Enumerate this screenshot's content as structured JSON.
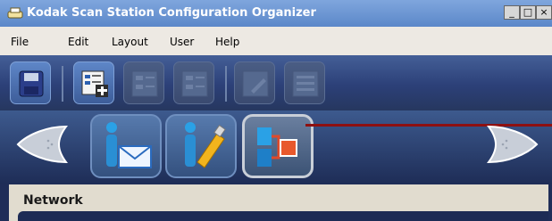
{
  "window": {
    "title": "Kodak Scan Station Configuration Organizer",
    "controls": {
      "minimize": "_",
      "maximize": "□",
      "close": "×"
    }
  },
  "menu": {
    "items": [
      "File",
      "Edit",
      "Layout",
      "User",
      "Help"
    ]
  },
  "toolbar": {
    "buttons": [
      {
        "icon": "save-icon",
        "enabled": true
      },
      {
        "icon": "add-config-icon",
        "enabled": true
      },
      {
        "icon": "config-icon",
        "enabled": false
      },
      {
        "icon": "config-icon",
        "enabled": false
      },
      {
        "icon": "edit-icon",
        "enabled": false
      },
      {
        "icon": "list-icon",
        "enabled": false
      }
    ]
  },
  "nav": {
    "tabs": [
      {
        "icon": "user-email-icon"
      },
      {
        "icon": "user-usb-icon"
      },
      {
        "icon": "network-icon",
        "selected": true
      }
    ],
    "prev_icon": "arrow-left-icon",
    "next_icon": "arrow-right-icon"
  },
  "panel": {
    "title": "Network"
  },
  "colors": {
    "titlebar": "#6a92d2",
    "toolbar": "#2c4078",
    "callout": "#8e1010",
    "panel": "#e1dccf"
  }
}
